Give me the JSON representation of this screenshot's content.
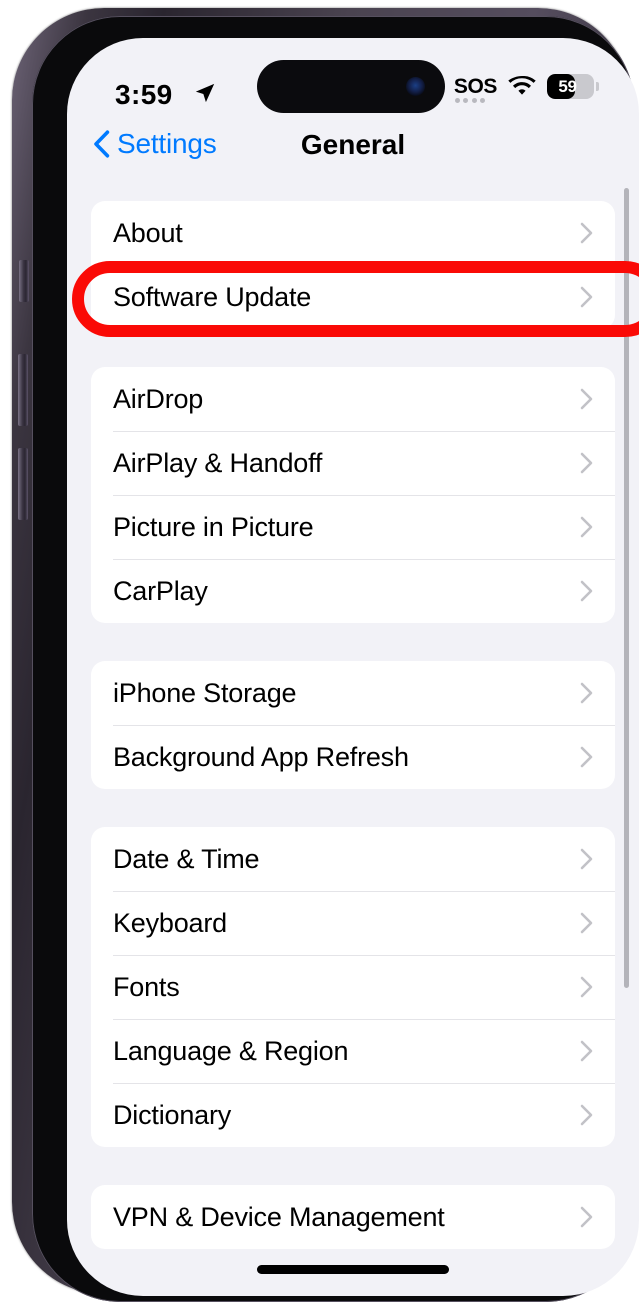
{
  "status_bar": {
    "time": "3:59",
    "location_icon": "location-arrow-icon",
    "sos_label": "SOS",
    "wifi_icon": "wifi-icon",
    "battery_percent": "59",
    "battery_fill_ratio": 0.59
  },
  "nav": {
    "back_label": "Settings",
    "back_icon": "back-chevron-icon",
    "title": "General"
  },
  "annotation": {
    "shape": "oval",
    "color": "#fa0a06",
    "target_row": "Software Update"
  },
  "groups": [
    {
      "id": "group-system",
      "rows": [
        {
          "label": "About",
          "chevron": "chevron-right-icon"
        },
        {
          "label": "Software Update",
          "chevron": "chevron-right-icon"
        }
      ]
    },
    {
      "id": "group-connectivity",
      "rows": [
        {
          "label": "AirDrop",
          "chevron": "chevron-right-icon"
        },
        {
          "label": "AirPlay & Handoff",
          "chevron": "chevron-right-icon"
        },
        {
          "label": "Picture in Picture",
          "chevron": "chevron-right-icon"
        },
        {
          "label": "CarPlay",
          "chevron": "chevron-right-icon"
        }
      ]
    },
    {
      "id": "group-storage",
      "rows": [
        {
          "label": "iPhone Storage",
          "chevron": "chevron-right-icon"
        },
        {
          "label": "Background App Refresh",
          "chevron": "chevron-right-icon"
        }
      ]
    },
    {
      "id": "group-localization",
      "rows": [
        {
          "label": "Date & Time",
          "chevron": "chevron-right-icon"
        },
        {
          "label": "Keyboard",
          "chevron": "chevron-right-icon"
        },
        {
          "label": "Fonts",
          "chevron": "chevron-right-icon"
        },
        {
          "label": "Language & Region",
          "chevron": "chevron-right-icon"
        },
        {
          "label": "Dictionary",
          "chevron": "chevron-right-icon"
        }
      ]
    },
    {
      "id": "group-bottom",
      "rows": [
        {
          "label": "VPN & Device Management",
          "chevron": "chevron-right-icon"
        }
      ]
    }
  ]
}
